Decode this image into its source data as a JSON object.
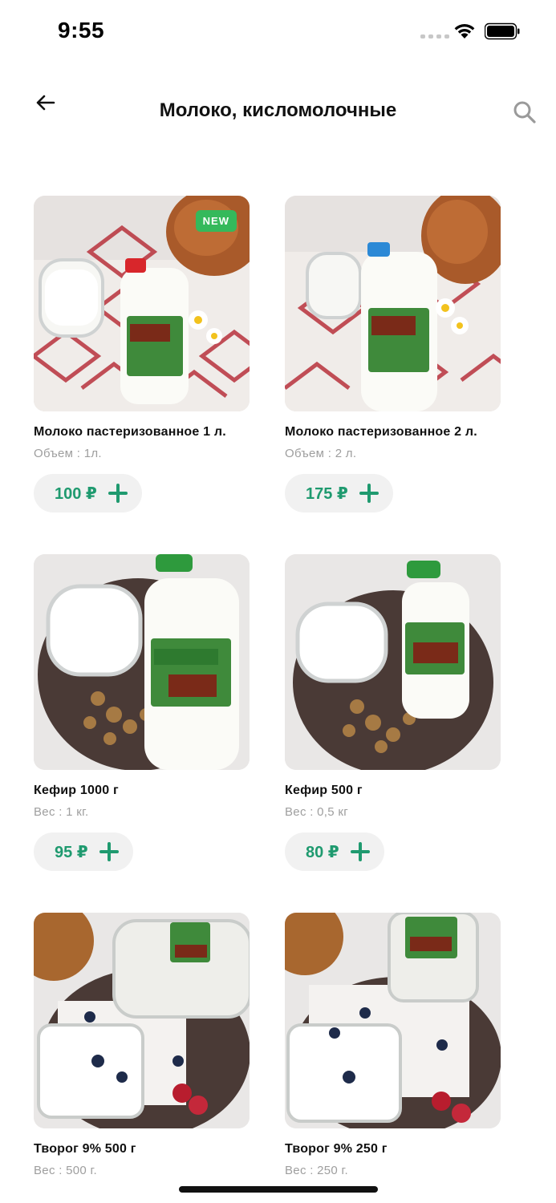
{
  "status_bar": {
    "time": "9:55"
  },
  "header": {
    "title": "Молоко, кисломолочные"
  },
  "products": [
    {
      "name": "Молоко пастеризованное 1 л.",
      "detail": "Объем : 1л.",
      "price": "100 ₽",
      "badge": "NEW",
      "cap_color": "#d8262b"
    },
    {
      "name": "Молоко пастеризованное 2 л.",
      "detail": "Объем : 2 л.",
      "price": "175 ₽",
      "badge": "",
      "cap_color": "#2c89d6"
    },
    {
      "name": "Кефир 1000 г",
      "detail": "Вес : 1 кг.",
      "price": "95 ₽",
      "badge": "",
      "cap_color": "#2e9a3d"
    },
    {
      "name": "Кефир 500 г",
      "detail": "Вес : 0,5 кг",
      "price": "80 ₽",
      "badge": "",
      "cap_color": "#2e9a3d"
    },
    {
      "name": "Творог 9% 500 г",
      "detail": "Вес : 500 г.",
      "price": "",
      "badge": "",
      "cap_color": ""
    },
    {
      "name": "Творог 9% 250 г",
      "detail": "Вес : 250 г.",
      "price": "",
      "badge": "",
      "cap_color": ""
    }
  ],
  "colors": {
    "accent": "#1f9a6f",
    "badge": "#35b95b",
    "pill_bg": "#f1f1f1",
    "muted_text": "#9e9e9e"
  },
  "icons": {
    "back": "arrow-left-icon",
    "search": "search-icon",
    "add": "plus-icon"
  }
}
